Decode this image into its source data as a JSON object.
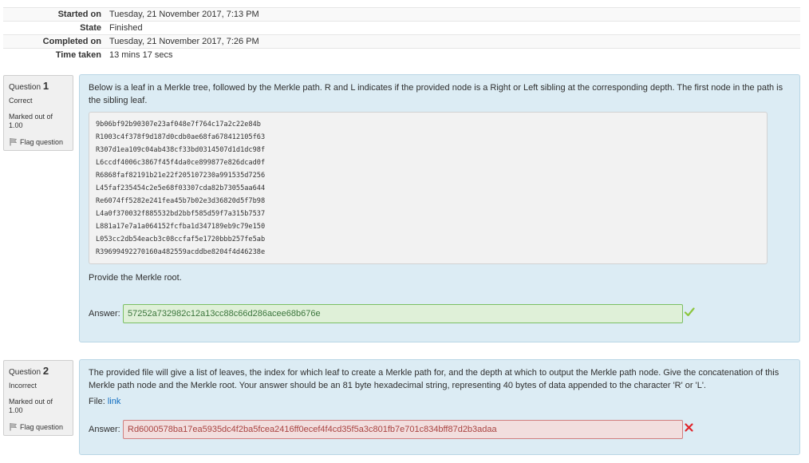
{
  "summary": [
    {
      "label": "Started on",
      "value": "Tuesday, 21 November 2017, 7:13 PM"
    },
    {
      "label": "State",
      "value": "Finished"
    },
    {
      "label": "Completed on",
      "value": "Tuesday, 21 November 2017, 7:26 PM"
    },
    {
      "label": "Time taken",
      "value": "13 mins 17 secs"
    }
  ],
  "questions": [
    {
      "label": "Question",
      "number": "1",
      "status": "Correct",
      "marked": "Marked out of 1.00",
      "flag_label": "Flag question",
      "text": "Below is a leaf in a Merkle tree, followed by the Merkle path. R and L indicates if the provided node is a Right or Left sibling at the corresponding depth. The first node in the path is the sibling leaf.",
      "code_lines": [
        "9b06bf92b90307e23af048e7f764c17a2c22e84b",
        "R1003c4f378f9d187d0cdb0ae68fa678412105f63",
        "R307d1ea109c04ab438cf33bd0314507d1d1dc98f",
        "L6ccdf4006c3867f45f4da0ce899877e826dcad0f",
        "R6868faf82191b21e22f205107230a991535d7256",
        "L45faf235454c2e5e68f03307cda82b73055aa644",
        "Re6074ff5282e241fea45b7b02e3d36820d5f7b98",
        "L4a0f370032f885532bd2bbf585d59f7a315b7537",
        "L881a17e7a1a064152fcfba1d347189eb9c79e150",
        "L053cc2db54eacb3c08ccfaf5e1720bbb257fe5ab",
        "R39699492270160a482559acddbe8204f4d46238e"
      ],
      "prompt": "Provide the Merkle root.",
      "answer_label": "Answer:",
      "answer_value": "57252a732982c12a13cc88c66d286acee68b676e",
      "result": "correct",
      "result_icon": "check-icon",
      "result_color": "#8cc63f"
    },
    {
      "label": "Question",
      "number": "2",
      "status": "Incorrect",
      "marked": "Marked out of 1.00",
      "flag_label": "Flag question",
      "text": "The provided file will give a list of leaves, the index for which leaf to create a Merkle path for, and the depth at which to output the Merkle path node. Give the concatenation of this Merkle path node and the Merkle root. Your answer should be an 81 byte hexadecimal string, representing 40 bytes of data appended to the character 'R' or 'L'.",
      "file_label": "File:",
      "file_link": "link",
      "answer_label": "Answer:",
      "answer_value": "Rd6000578ba17ea5935dc4f2ba5fcea2416ff0ecef4f4cd35f5a3c801fb7e701c834bff87d2b3adaa",
      "result": "incorrect",
      "result_icon": "cross-icon",
      "result_color": "#e0262c"
    }
  ],
  "colors": {
    "content_bg": "#dcecf4",
    "info_bg": "#f0f0f0",
    "correct_bg": "#dff0d8",
    "incorrect_bg": "#f2dede",
    "link": "#0f6cbf"
  }
}
